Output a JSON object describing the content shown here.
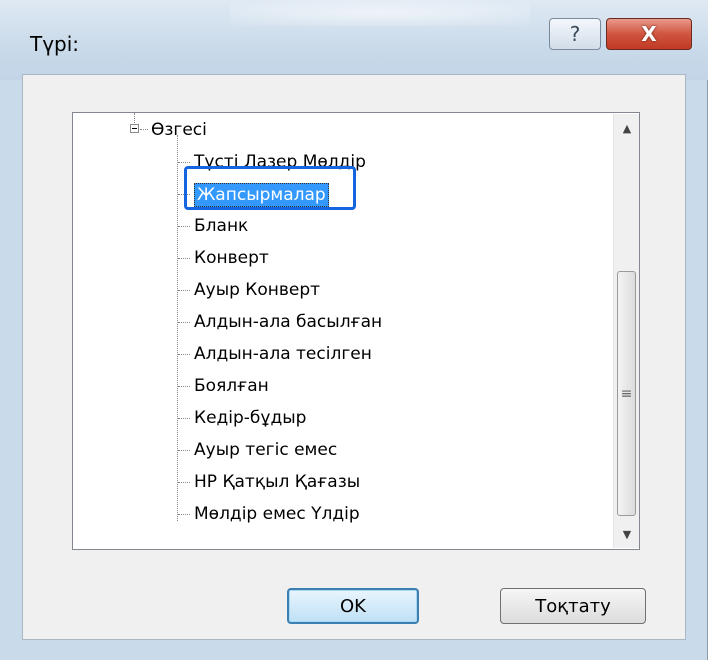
{
  "dialog": {
    "title": "Түрі:",
    "help_glyph": "?",
    "close_glyph": "X"
  },
  "tree": {
    "parent_label": "Өзгесі",
    "children": [
      "Түсті Лазер Мөлдір",
      "Жапсырмалар",
      "Бланк",
      "Конверт",
      "Ауыр Конверт",
      "Алдын-ала басылған",
      "Алдын-ала тесілген",
      "Боялған",
      "Кедір-бұдыр",
      "Ауыр тегіс емес",
      "HP Қатқыл Қағазы",
      "Мөлдір емес Үлдір"
    ],
    "selected_index": 1
  },
  "scrollbar": {
    "up_glyph": "▲",
    "down_glyph": "▼",
    "grip_glyph": "≡"
  },
  "buttons": {
    "ok_label": "OK",
    "cancel_label": "Тоқтату"
  },
  "colors": {
    "selection": "#3399ff",
    "callout": "#1565e0",
    "close_button": "#c13a24"
  }
}
